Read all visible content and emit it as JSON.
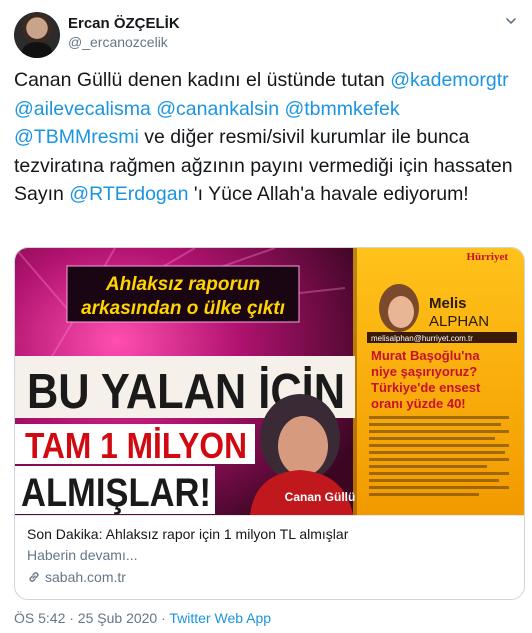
{
  "author": {
    "display_name": "Ercan ÖZÇELİK",
    "handle": "@_ercanozcelik"
  },
  "tweet": {
    "line1_a": "Canan Güllü denen kadını el üstünde tutan",
    "m1": "@kademorgtr",
    "m2": "@ailevecalisma",
    "m3": "@canankalsin",
    "m4": "@tbmmkefek",
    "m5": "@TBMMresmi",
    "text_b": " ve diğer resmi/sivil kurumlar ile bunca tezviratına rağmen ağzının payını vermediği için hassaten Sayın ",
    "m6": "@RTErdogan",
    "text_c": " 'ı Yüce Allah'a havale ediyorum!"
  },
  "card_image": {
    "banner": "Ahlaksız raporun arkasından o ülke çıktı",
    "headline1": "BU YALAN İÇİN",
    "headline2": "TAM 1 MİLYON",
    "headline3": "ALMIŞLAR!",
    "person_caption": "Canan Güllü",
    "newspaper": "Hürriyet",
    "columnist_first": "Melis",
    "columnist_last": "ALPHAN",
    "columnist_email": "melisalphan@hurriyet.com.tr",
    "column_q1": "Murat Başoğlu'na",
    "column_q2": "niye şaşırıyoruz?",
    "column_q3": "Türkiye'de ensest",
    "column_q4": "oranı yüzde 40!"
  },
  "card": {
    "title": "Son Dakika: Ahlaksız rapor için 1 milyon TL almışlar",
    "description": "Haberin devamı...",
    "domain": "sabah.com.tr"
  },
  "footer": {
    "time_date": "ÖS 5:42 · 25 Şub 2020 · ",
    "app": "Twitter Web App"
  },
  "colors": {
    "link": "#1b95e0",
    "secondary": "#657786",
    "headline_red": "#d10a12",
    "paper_yellow": "#f6b400"
  }
}
